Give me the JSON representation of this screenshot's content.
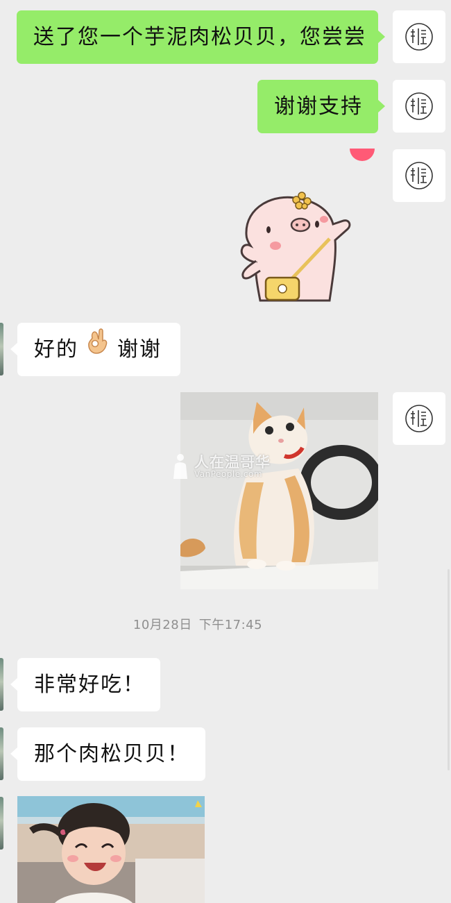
{
  "messages": {
    "m1": {
      "sender": "self",
      "text": "送了您一个芋泥肉松贝贝，您尝尝"
    },
    "m2": {
      "sender": "self",
      "text": "谢谢支持"
    },
    "m3": {
      "sender": "self",
      "type": "sticker",
      "icon": "pig-sticker-icon"
    },
    "m4": {
      "sender": "peer",
      "text_before": "好的",
      "emoji": "ok-hand-icon",
      "text_after": "谢谢"
    },
    "m5": {
      "sender": "self",
      "type": "image",
      "icon": "cat-photo"
    },
    "m6": {
      "sender": "peer",
      "text": "非常好吃！"
    },
    "m7": {
      "sender": "peer",
      "text": "那个肉松贝贝！"
    },
    "m8": {
      "sender": "peer",
      "type": "image",
      "icon": "girl-photo"
    }
  },
  "timestamp": {
    "date": "10月28日",
    "time": "下午17:45"
  },
  "watermark": {
    "title": "人在温哥华",
    "subtitle": "VanPeople.com"
  },
  "colors": {
    "background": "#ededed",
    "self_bubble": "#95ec69",
    "peer_bubble": "#ffffff",
    "timestamp_text": "#8f8f8f"
  }
}
